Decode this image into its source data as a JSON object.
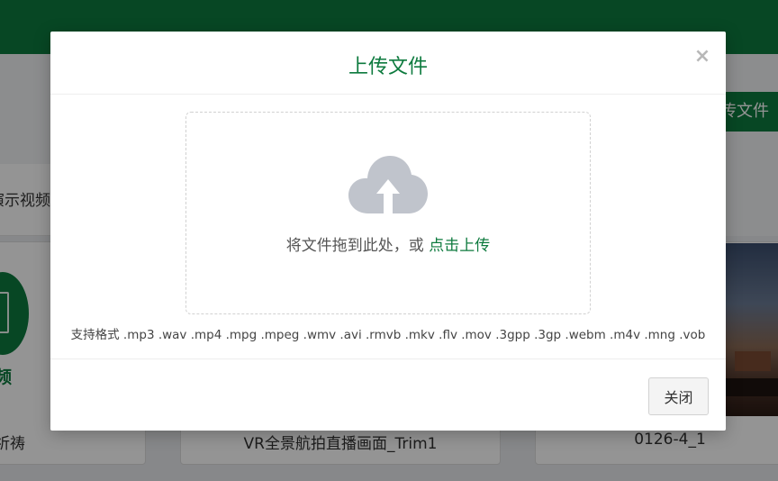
{
  "background": {
    "upload_button_label": "传文件",
    "tab_label": "演示视频",
    "card_1_heading": "频",
    "card_1_title": "祈祷",
    "card_2_title": "VR全景航拍直播画面_Trim1",
    "card_3_title": "0126-4_1"
  },
  "modal": {
    "title": "上传文件",
    "close_icon": "×",
    "dropzone": {
      "icon": "cloud-upload-icon",
      "prompt": "将文件拖到此处，或 ",
      "link": "点击上传"
    },
    "formats": "支持格式 .mp3 .wav .mp4 .mpg .mpeg .wmv .avi .rmvb .mkv .flv .mov .3gpp .3gp .webm .m4v .mng .vob",
    "footer": {
      "close_label": "关闭"
    }
  },
  "colors": {
    "brand_green": "#0d7a3e",
    "icon_gray": "#c0c4cc"
  }
}
